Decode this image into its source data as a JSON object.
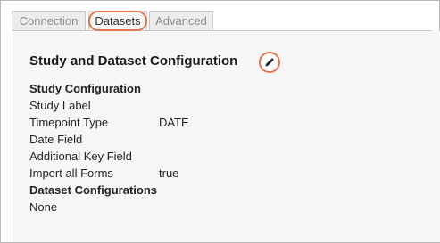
{
  "tabs": [
    {
      "label": "Connection"
    },
    {
      "label": "Datasets"
    },
    {
      "label": "Advanced"
    }
  ],
  "section": {
    "title": "Study and Dataset Configuration",
    "edit_icon": "pencil-icon"
  },
  "study_configuration": {
    "heading": "Study Configuration",
    "fields": [
      {
        "label": "Study Label",
        "value": ""
      },
      {
        "label": "Timepoint Type",
        "value": "DATE"
      },
      {
        "label": "Date Field",
        "value": ""
      },
      {
        "label": "Additional Key Field",
        "value": ""
      },
      {
        "label": "Import all Forms",
        "value": "true"
      }
    ]
  },
  "dataset_configurations": {
    "heading": "Dataset Configurations",
    "value": "None"
  },
  "colors": {
    "highlight": "#e2754f",
    "panel_bg": "#f6f6f6"
  }
}
